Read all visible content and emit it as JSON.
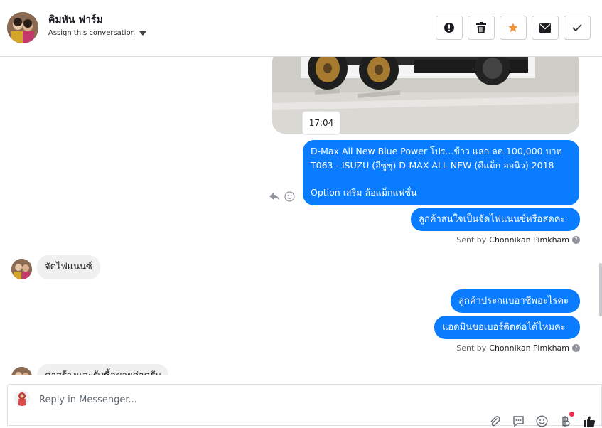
{
  "header": {
    "contact_name": "คิมหัน ฟาร์ม",
    "assign_label": "Assign this conversation",
    "actions": [
      {
        "name": "spam-button",
        "icon": "exclamation-icon"
      },
      {
        "name": "delete-button",
        "icon": "trash-icon"
      },
      {
        "name": "star-button",
        "icon": "star-icon"
      },
      {
        "name": "mark-unread-button",
        "icon": "envelope-icon"
      },
      {
        "name": "mark-done-button",
        "icon": "check-icon"
      }
    ]
  },
  "thread": {
    "photo_time": "17:04",
    "outgoing_1": {
      "line1": "D-Max All New Blue Power โปร...ข้าว แลก ลด 100,000 บาท",
      "line2": "T063 - ISUZU (อีซูซุ) D-MAX ALL NEW (ดีแม็ก ออนิว) 2018",
      "line3": "Option เสริม ล้อแม็กแฟชั่น"
    },
    "outgoing_2": "ลูกค้าสนใจเป็นจัดไฟแนนซ์หรือสดคะ",
    "sent_by_1": {
      "prefix": "Sent by",
      "name": "Chonnikan Pimkham"
    },
    "incoming_1": "จัดไฟแนนซ์",
    "outgoing_3": "ลูกค้าประกแบอาชีพอะไรคะ",
    "outgoing_4": "แอดมินขอเบอร์ติดต่อได้ไหมคะ",
    "sent_by_2": {
      "prefix": "Sent by",
      "name": "Chonnikan Pimkham"
    },
    "incoming_2": "ค่าสร้างและรับซื้อขายค่าครับ"
  },
  "composer": {
    "placeholder": "Reply in Messenger..."
  },
  "colors": {
    "accent": "#0a7cff",
    "star": "#f7923a",
    "notification_dot": "#f02849"
  }
}
